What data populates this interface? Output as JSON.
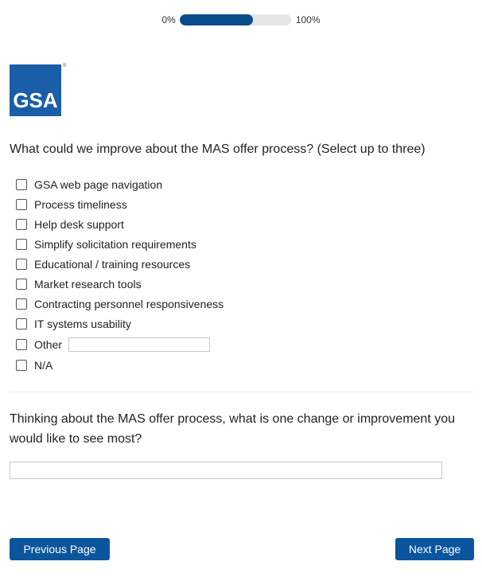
{
  "progress": {
    "start_label": "0%",
    "end_label": "100%",
    "fraction": 0.66
  },
  "logo": {
    "text": "GSA",
    "reg_mark": "®",
    "color": "#1b5ea8"
  },
  "question1": {
    "text": "What could we improve about the MAS offer process? (Select up to three)",
    "options": [
      "GSA web page navigation",
      "Process timeliness",
      "Help desk support",
      "Simplify solicitation requirements",
      "Educational / training resources",
      "Market research tools",
      "Contracting personnel responsiveness",
      "IT systems usability",
      "Other",
      "N/A"
    ],
    "other_value": ""
  },
  "question2": {
    "text": "Thinking about the MAS offer process, what is one change or improvement you would like to see most?",
    "value": ""
  },
  "nav": {
    "previous_label": "Previous Page",
    "next_label": "Next Page",
    "accent": "#0b559c"
  }
}
